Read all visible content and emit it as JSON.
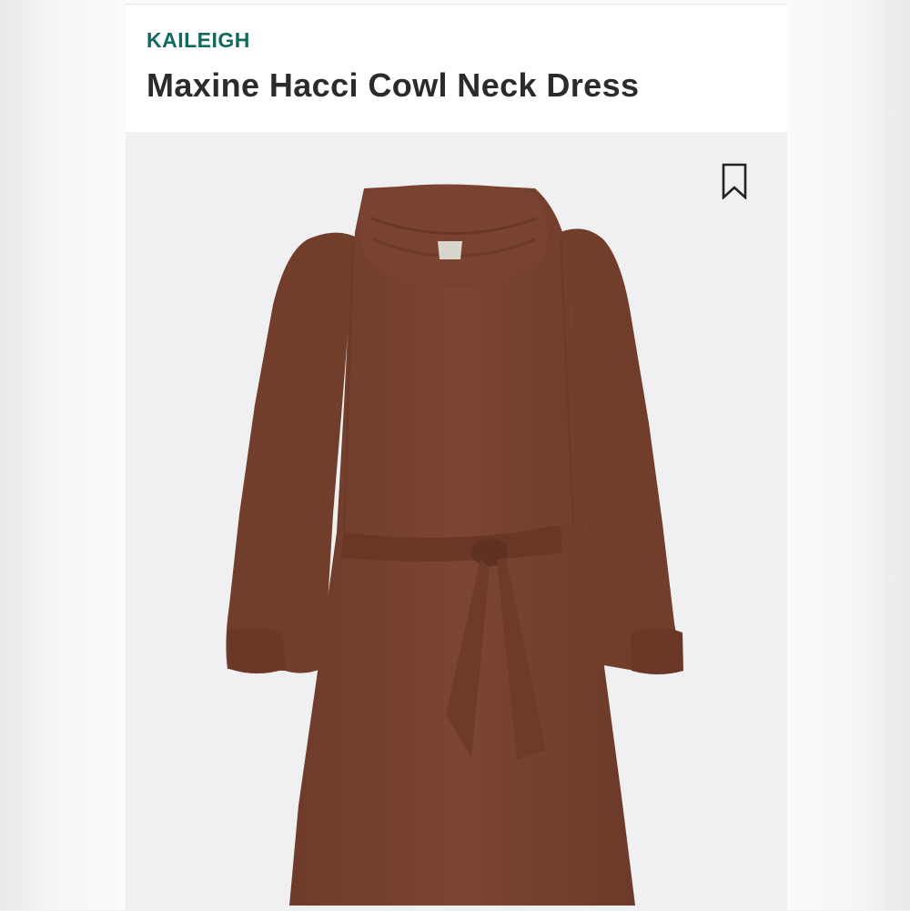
{
  "product": {
    "brand": "KAILEIGH",
    "name": "Maxine Hacci Cowl Neck Dress"
  },
  "photo": {
    "bookmark_icon": "bookmark-icon",
    "garment_color": "#7a4431",
    "background_color": "#f0f0f2"
  },
  "colors": {
    "brand_accent": "#0f6b5c",
    "title_text": "#2b2b2b"
  }
}
